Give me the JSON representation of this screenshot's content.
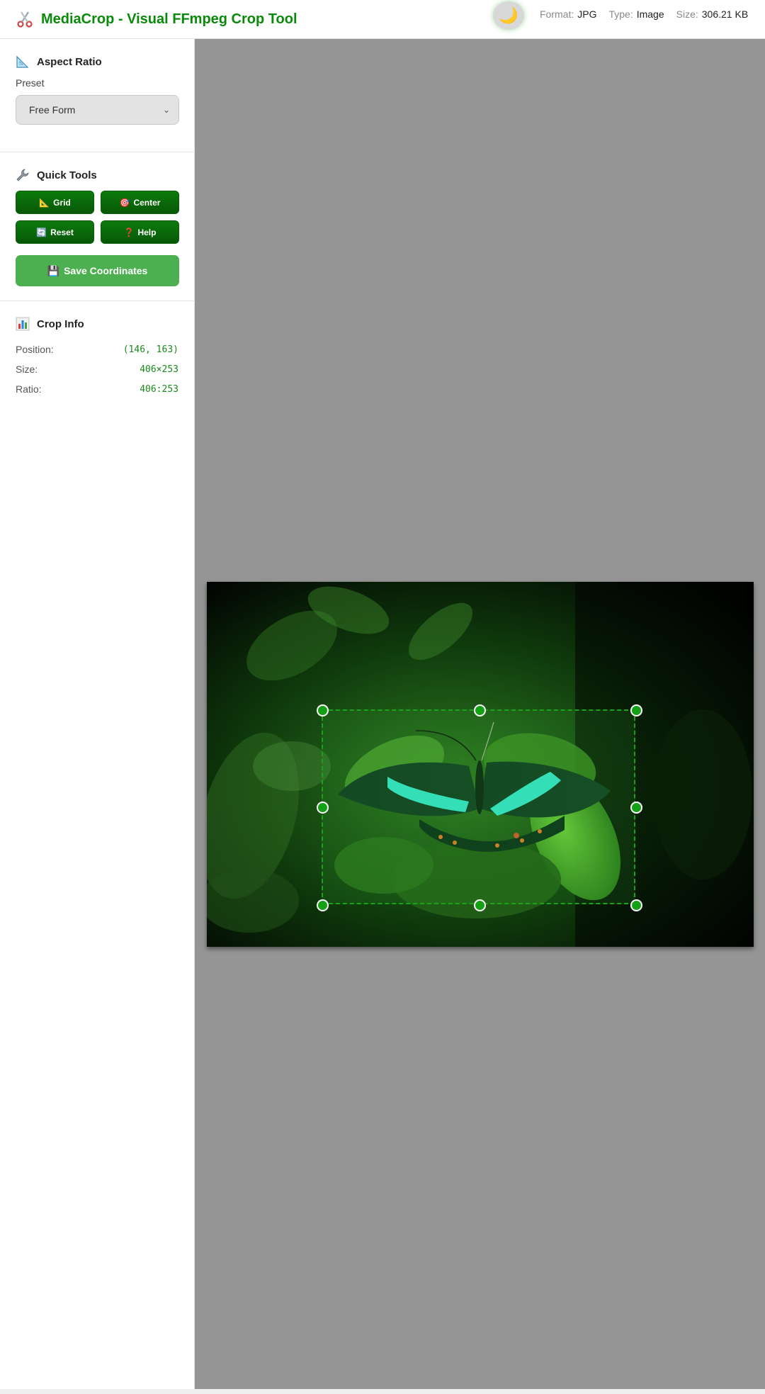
{
  "app": {
    "title": "MediaCrop - Visual FFmpeg Crop Tool",
    "theme_icon": "moon-icon",
    "accent_color": "#0a8a0a"
  },
  "file_meta": {
    "format_label": "Format:",
    "format_value": "JPG",
    "type_label": "Type:",
    "type_value": "Image",
    "size_label": "Size:",
    "size_value": "306.21 KB"
  },
  "aspect": {
    "title": "Aspect Ratio",
    "preset_label": "Preset",
    "preset_value": "Free Form"
  },
  "tools": {
    "title": "Quick Tools",
    "grid_label": "Grid",
    "center_label": "Center",
    "reset_label": "Reset",
    "help_label": "Help",
    "save_label": "Save Coordinates"
  },
  "crop_info": {
    "title": "Crop Info",
    "position_label": "Position:",
    "position_value": "(146, 163)",
    "size_label": "Size:",
    "size_value": "406×253",
    "ratio_label": "Ratio:",
    "ratio_value": "406:253"
  }
}
